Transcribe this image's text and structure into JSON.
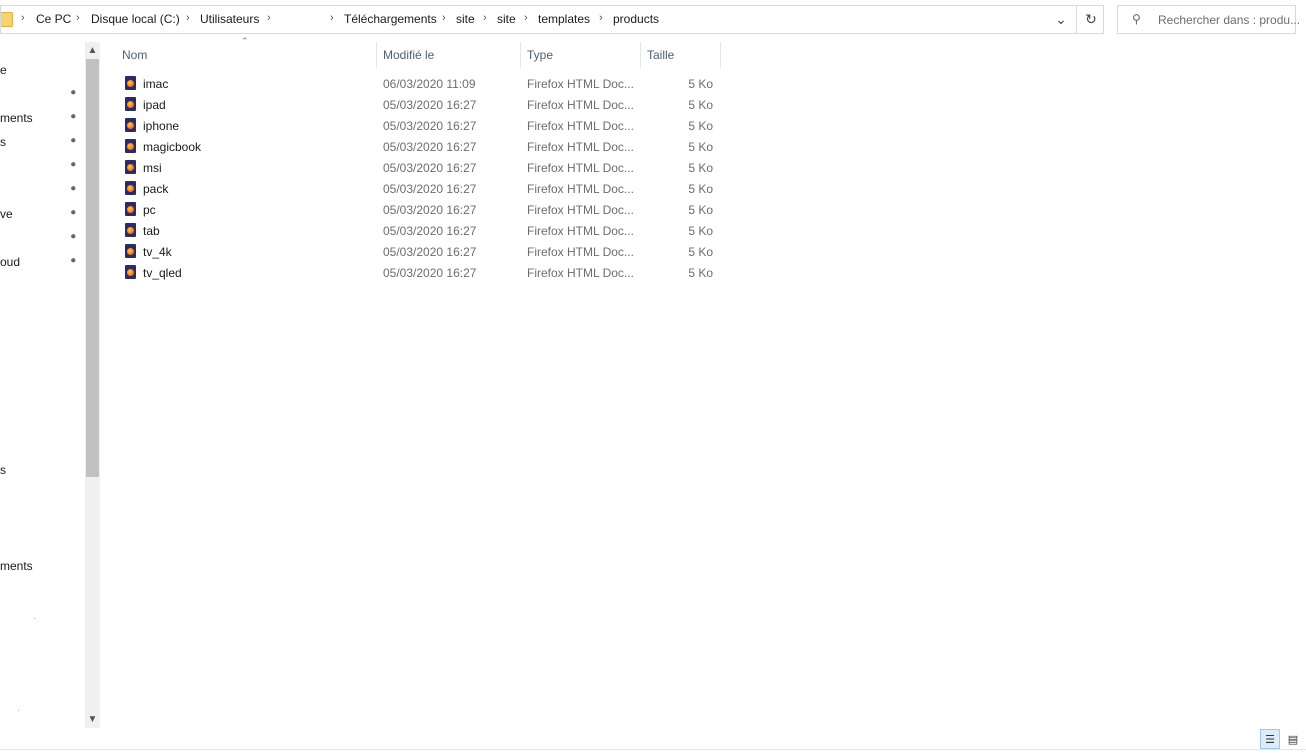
{
  "address": {
    "crumbs": [
      "Ce PC",
      "Disque local (C:)",
      "Utilisateurs",
      "Téléchargements",
      "site",
      "site",
      "templates",
      "products"
    ],
    "separator": "›",
    "dropdown_icon": "chevron-down-icon",
    "refresh_icon": "refresh-icon"
  },
  "search": {
    "placeholder": "Rechercher dans : produ..."
  },
  "nav": {
    "items": [
      "e",
      "ments",
      "s",
      "ve",
      "oud",
      "s",
      "ments"
    ]
  },
  "columns": {
    "name": "Nom",
    "modified": "Modifié le",
    "type": "Type",
    "size": "Taille"
  },
  "files": [
    {
      "name": "imac",
      "modified": "06/03/2020 11:09",
      "type": "Firefox HTML Doc...",
      "size": "5 Ko"
    },
    {
      "name": "ipad",
      "modified": "05/03/2020 16:27",
      "type": "Firefox HTML Doc...",
      "size": "5 Ko"
    },
    {
      "name": "iphone",
      "modified": "05/03/2020 16:27",
      "type": "Firefox HTML Doc...",
      "size": "5 Ko"
    },
    {
      "name": "magicbook",
      "modified": "05/03/2020 16:27",
      "type": "Firefox HTML Doc...",
      "size": "5 Ko"
    },
    {
      "name": "msi",
      "modified": "05/03/2020 16:27",
      "type": "Firefox HTML Doc...",
      "size": "5 Ko"
    },
    {
      "name": "pack",
      "modified": "05/03/2020 16:27",
      "type": "Firefox HTML Doc...",
      "size": "5 Ko"
    },
    {
      "name": "pc",
      "modified": "05/03/2020 16:27",
      "type": "Firefox HTML Doc...",
      "size": "5 Ko"
    },
    {
      "name": "tab",
      "modified": "05/03/2020 16:27",
      "type": "Firefox HTML Doc...",
      "size": "5 Ko"
    },
    {
      "name": "tv_4k",
      "modified": "05/03/2020 16:27",
      "type": "Firefox HTML Doc...",
      "size": "5 Ko"
    },
    {
      "name": "tv_qled",
      "modified": "05/03/2020 16:27",
      "type": "Firefox HTML Doc...",
      "size": "5 Ko"
    }
  ],
  "colors": {
    "header_text": "#4c607a",
    "secondary_text": "#6d6d6d",
    "selection_blue": "#dcecfb"
  }
}
